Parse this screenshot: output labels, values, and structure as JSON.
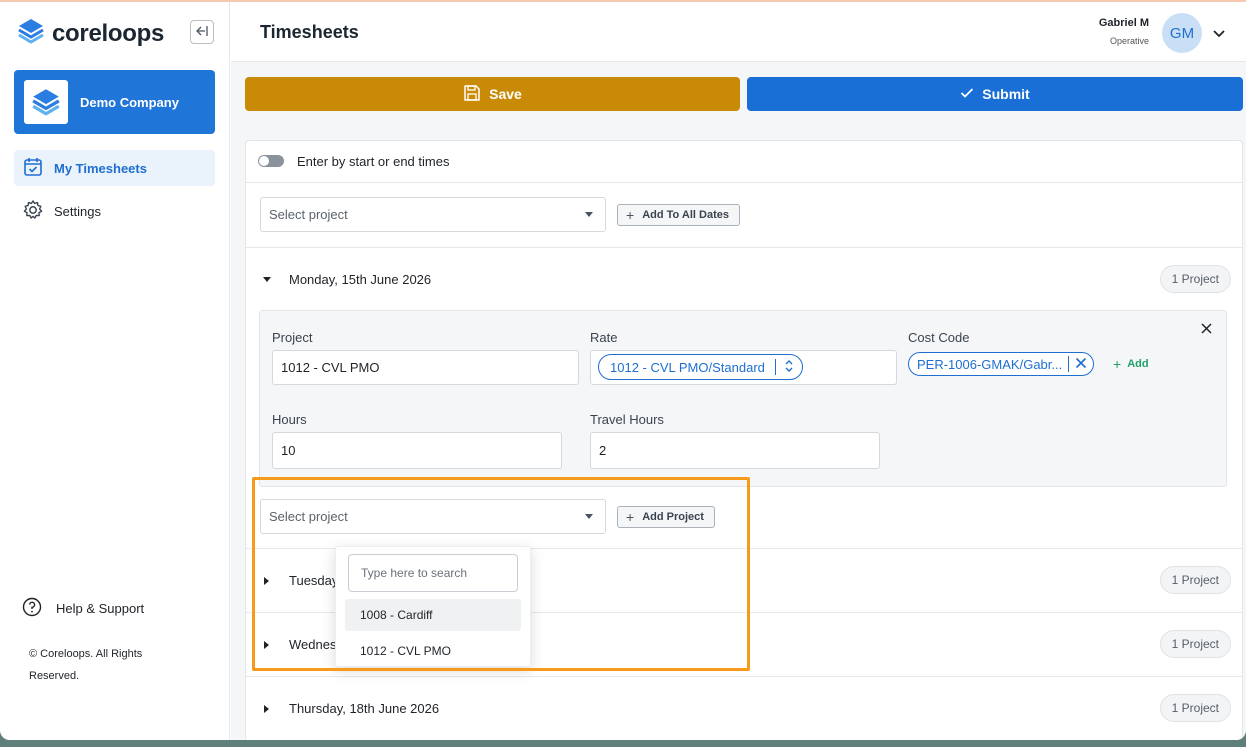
{
  "app": {
    "brand": "coreloops",
    "company": "Demo Company",
    "page_title": "Timesheets"
  },
  "sidebar": {
    "items": [
      {
        "label": "My Timesheets",
        "icon": "calendar-check-icon",
        "active": true
      },
      {
        "label": "Settings",
        "icon": "gear-icon",
        "active": false
      }
    ],
    "help_label": "Help & Support",
    "copyright": "© Coreloops. All Rights Reserved."
  },
  "user": {
    "name": "Gabriel M",
    "role": "Operative",
    "initials": "GM"
  },
  "toolbar": {
    "save_label": "Save",
    "submit_label": "Submit",
    "save_color": "#c98a08",
    "submit_color": "#1a6fd6"
  },
  "form": {
    "toggle_label": "Enter by start or end times",
    "toggle_on": false,
    "select_project_placeholder": "Select project",
    "add_to_all_dates_label": "Add To All Dates"
  },
  "days": [
    {
      "label": "Monday, 15th June 2026",
      "count_label": "1 Project",
      "expanded": true
    },
    {
      "label": "Tuesday",
      "count_label": "1 Project",
      "expanded": false
    },
    {
      "label": "Wednes",
      "count_label": "1 Project",
      "expanded": false
    },
    {
      "label": "Thursday, 18th June 2026",
      "count_label": "1 Project",
      "expanded": false
    }
  ],
  "entry": {
    "project_label": "Project",
    "project_value": "1012 - CVL PMO",
    "rate_label": "Rate",
    "rate_value": "1012 - CVL PMO/Standard",
    "cost_code_label": "Cost Code",
    "cost_code_value": "PER-1006-GMAK/Gabr...",
    "add_label": "Add",
    "hours_label": "Hours",
    "hours_value": "10",
    "travel_hours_label": "Travel Hours",
    "travel_hours_value": "2"
  },
  "add_project": {
    "placeholder": "Select project",
    "button_label": "Add Project"
  },
  "dropdown": {
    "search_placeholder": "Type here to search",
    "options": [
      "1008 - Cardiff",
      "1012 - CVL PMO"
    ],
    "hovered_index": 0
  },
  "colors": {
    "accent": "#1f75d8",
    "highlight": "#f59a1b",
    "add_link": "#21a06a"
  }
}
